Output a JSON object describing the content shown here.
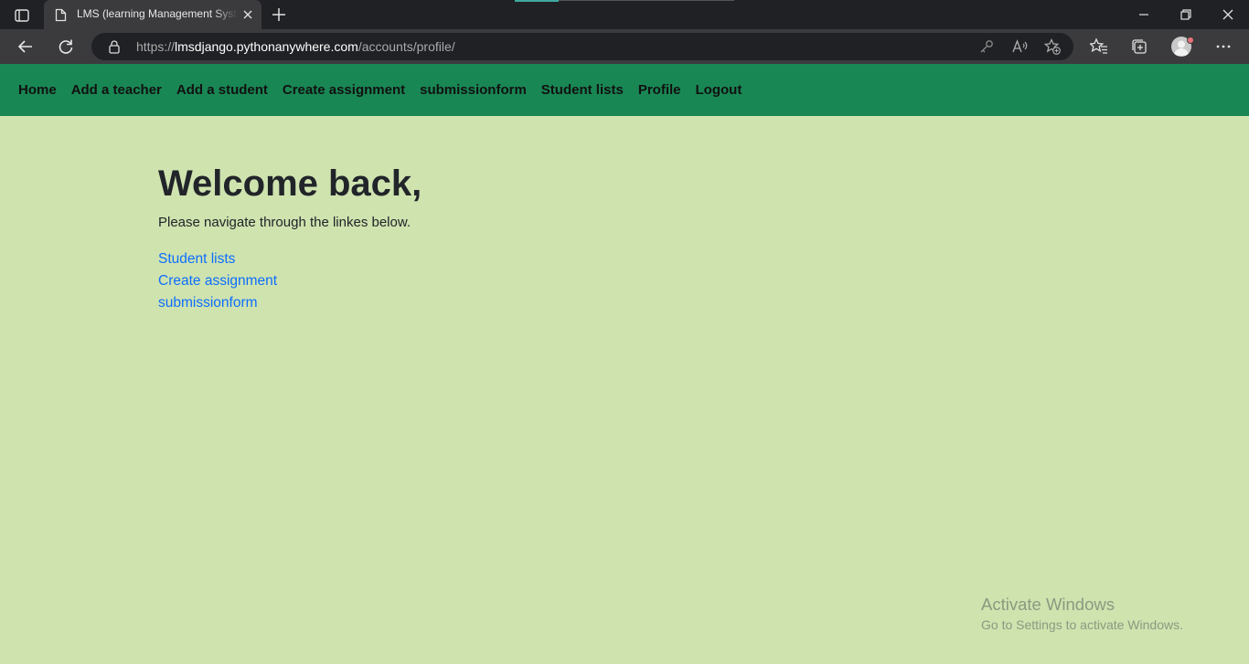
{
  "browser": {
    "tab": {
      "title": "LMS (learning Management System)"
    },
    "address": {
      "scheme": "https://",
      "host": "lmsdjango.pythonanywhere.com",
      "path": "/accounts/profile/"
    },
    "icons": [
      "tab-actions-icon",
      "document-icon",
      "close-icon",
      "plus-icon",
      "minimize-icon",
      "restore-icon",
      "window-close-icon",
      "back-arrow-icon",
      "refresh-icon",
      "lock-icon",
      "key-icon",
      "read-aloud-icon",
      "add-favorite-icon",
      "favorites-icon",
      "collections-icon",
      "profile-icon",
      "more-icon"
    ]
  },
  "navbar": {
    "background": "#198754",
    "links": [
      "Home",
      "Add a teacher",
      "Add a student",
      "Create assignment",
      "submissionform",
      "Student lists",
      "Profile",
      "Logout"
    ]
  },
  "main": {
    "heading": "Welcome back,",
    "subtitle": "Please navigate through the linkes below.",
    "links": [
      "Student lists",
      "Create assignment",
      "submissionform"
    ],
    "link_color": "#0d6efd",
    "background": "#cfe3af"
  },
  "watermark": {
    "line1": "Activate Windows",
    "line2": "Go to Settings to activate Windows."
  }
}
